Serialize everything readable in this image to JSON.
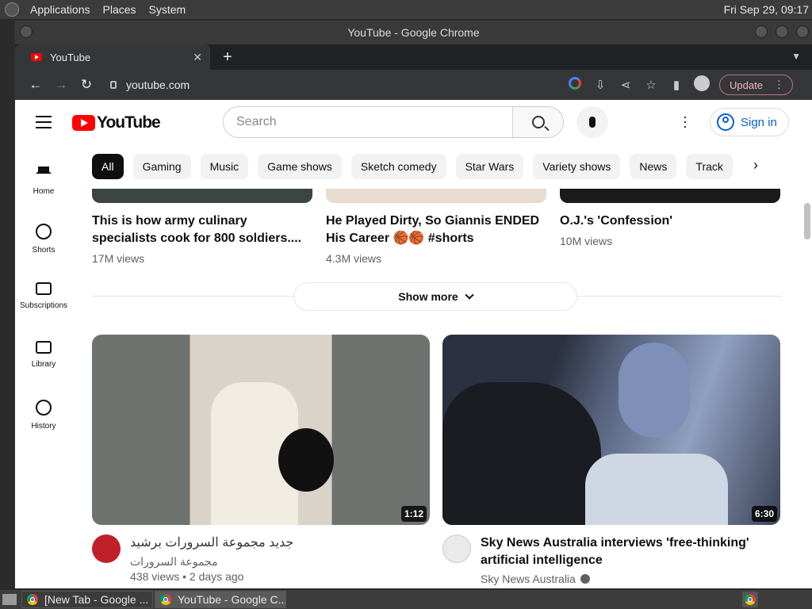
{
  "os": {
    "menus": [
      "Applications",
      "Places",
      "System"
    ],
    "clock": "Fri Sep 29, 09:17"
  },
  "window": {
    "title": "YouTube - Google Chrome"
  },
  "browser": {
    "tab_title": "YouTube",
    "tab_close": "✕",
    "new_tab": "+",
    "back": "←",
    "forward": "→",
    "reload": "↻",
    "url": "youtube.com",
    "update_label": "Update"
  },
  "youtube": {
    "logo_text": "YouTube",
    "search_placeholder": "Search",
    "signin_label": "Sign in",
    "chips": [
      "All",
      "Gaming",
      "Music",
      "Game shows",
      "Sketch comedy",
      "Star Wars",
      "Variety shows",
      "News",
      "Track"
    ],
    "sidebar": [
      {
        "label": "Home",
        "icon": "home-icon"
      },
      {
        "label": "Shorts",
        "icon": "shorts-icon"
      },
      {
        "label": "Subscriptions",
        "icon": "subscriptions-icon"
      },
      {
        "label": "Library",
        "icon": "library-icon"
      },
      {
        "label": "History",
        "icon": "history-icon"
      }
    ],
    "shorts": [
      {
        "title": "This is how army culinary specialists cook for 800 soldiers....",
        "views": "17M views"
      },
      {
        "title": "He Played Dirty, So Giannis ENDED His Career 🏀🏀 #shorts",
        "views": "4.3M views"
      },
      {
        "title": "O.J.'s 'Confession'",
        "views": "10M views"
      }
    ],
    "show_more": "Show more",
    "videos": [
      {
        "title": "جديد مجموعة السرورات برشيد",
        "channel": "مجموعة السرورات",
        "stats": "438 views • 2 days ago",
        "duration": "1:12"
      },
      {
        "title": "Sky News Australia interviews 'free-thinking' artificial intelligence",
        "channel": "Sky News Australia",
        "stats": "",
        "duration": "6:30"
      }
    ]
  },
  "taskbar": {
    "tasks": [
      "[New Tab - Google ...",
      "YouTube - Google C..."
    ]
  },
  "colors": {
    "yt_red": "#ff0000",
    "link_blue": "#065fd4",
    "chrome_dark": "#35363a"
  }
}
